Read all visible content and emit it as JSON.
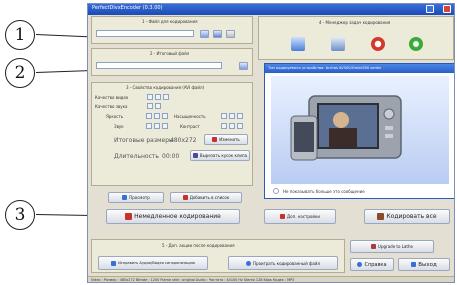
{
  "callouts": [
    "1",
    "2",
    "3"
  ],
  "window": {
    "title": "PerfectDivxEncoder (0.3.00)"
  },
  "section1": {
    "title": "1 - Файл для кодирования"
  },
  "section2": {
    "title": "2 - Итоговый файл"
  },
  "section3": {
    "title": "3 - Свойства кодирования (AVI файл)",
    "quality_video": "Качество видео",
    "quality_audio": "Качество звука",
    "brightness": "Яркость",
    "saturation": "Насыщенность",
    "sound": "Звук",
    "contrast": "Контраст",
    "final_size_label": "Итоговые размеры",
    "final_size_value": "480x272",
    "change": "Изменить",
    "duration_label": "Длительность",
    "duration_value": "00:00",
    "cut_clip": "Вырезать кусок клипа"
  },
  "section4": {
    "title": "4 - Менеджер задач кодирования"
  },
  "popup": {
    "title": "Тип кодируемого устройства: Archos AV500/Gmini500 series",
    "no_show": "Не показывать больше это сообщение"
  },
  "buttons": {
    "preview": "Просмотр",
    "add_to_list": "Добавить в список",
    "encode_now": "Немедленное кодирование",
    "settings": "Доп. настройки",
    "encode_all": "Кодировать все",
    "upgrade": "Upgrade to Lathe",
    "fix_av": "Исправить Аудио/Видео синхронизацию",
    "play_encoded": "Проиграть кодированный файл",
    "help": "Справка",
    "exit": "Выход"
  },
  "section5": {
    "title": "5 - Доп. акции после кодирования"
  },
  "status": "Video : Размер : 480x272    Bitrate : 1200    Frame rate : original    Audio :    Частота : 44100 Hz    Stereo    128 Kbps    Кодек : MP3",
  "colors": {
    "titlebar": "#2a5cc9",
    "accent_red": "#c8302b",
    "accent_green": "#3aa83a"
  }
}
